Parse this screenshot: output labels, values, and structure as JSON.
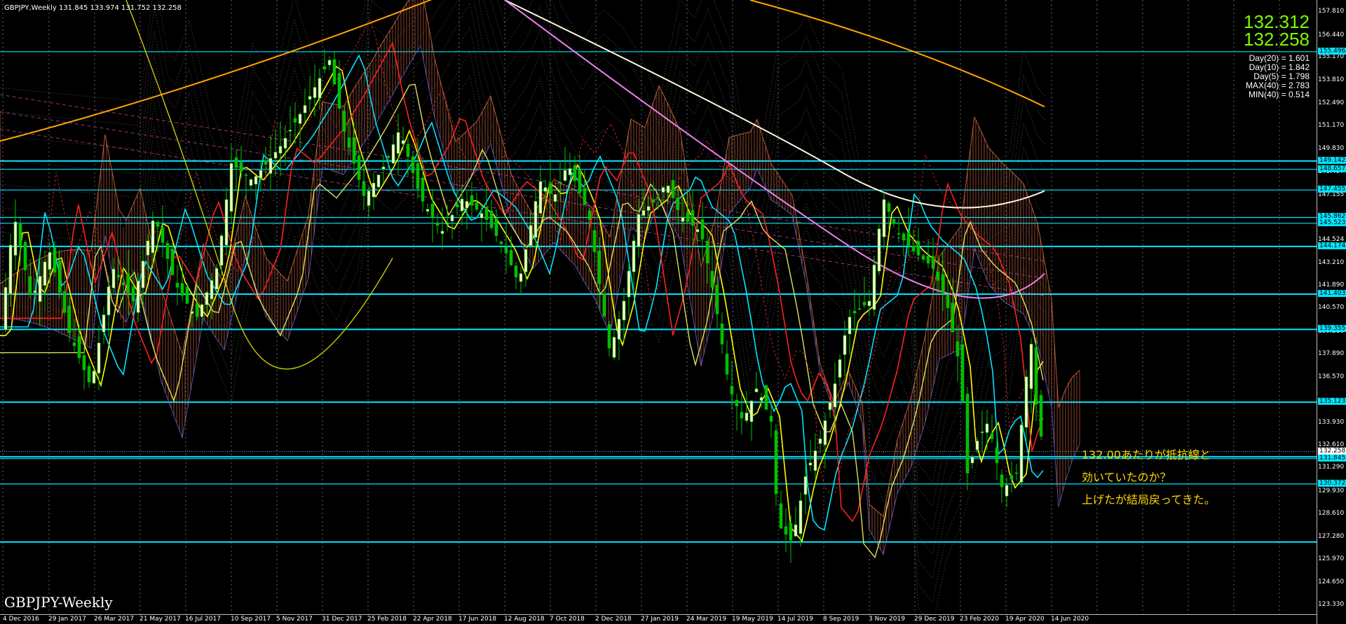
{
  "header": {
    "title": "GBPJPY,Weekly  131.845 133.974 131.752 132.258"
  },
  "symbol_label": "GBPJPY-Weekly",
  "quote": {
    "bid": "132.312",
    "ask": "132.258"
  },
  "stats": [
    "Day(20) = 1.601",
    "Day(10) = 1.842",
    "Day(5) = 1.798",
    "MAX(40) = 2.783",
    "MIN(40) = 0.514"
  ],
  "annotation": [
    "132.00あたりが抵抗線と",
    "効いていたのか？",
    "上げたが結局戻ってきた。"
  ],
  "price_ticks": [
    "157.810",
    "156.440",
    "155.170",
    "153.810",
    "152.490",
    "151.170",
    "149.830",
    "148.497",
    "147.155",
    "145.862",
    "144.524",
    "143.210",
    "141.890",
    "140.570",
    "139.210",
    "137.890",
    "136.570",
    "135.123",
    "133.930",
    "132.610",
    "131.290",
    "129.930",
    "128.610",
    "127.280",
    "125.970",
    "124.650",
    "123.330"
  ],
  "levels": [
    "155.496",
    "149.142",
    "148.657",
    "147.455",
    "145.862",
    "145.523",
    "144.174",
    "141.403",
    "139.355",
    "135.123",
    "132.258",
    "131.845",
    "130.372"
  ],
  "date_ticks": [
    "4 Dec 2016",
    "29 Jan 2017",
    "26 Mar 2017",
    "21 May 2017",
    "16 Jul 2017",
    "10 Sep 2017",
    "5 Nov 2017",
    "31 Dec 2017",
    "25 Feb 2018",
    "22 Apr 2018",
    "17 Jun 2018",
    "12 Aug 2018",
    "7 Oct 2018",
    "2 Dec 2018",
    "27 Jan 2019",
    "24 Mar 2019",
    "19 May 2019",
    "14 Jul 2019",
    "8 Sep 2019",
    "3 Nov 2019",
    "29 Dec 2019",
    "23 Feb 2020",
    "19 Apr 2020",
    "14 Jun 2020"
  ],
  "colors": {
    "background": "#000000",
    "candle_up": "#ffffcc",
    "candle_down": "#00c000",
    "level_line": "#00e5ff",
    "bid_ask": "#7cfc00",
    "annotation": "#ffd700",
    "ma_fast": "#ffff00",
    "ma_mid": "#00e5ff",
    "ma_slow": "#ff2020",
    "ma_long": "#e0e060",
    "ma_orange": "#ffa500",
    "ma_pink": "#ee82ee",
    "ma_cream": "#fff5dc",
    "cloud_bull": "#ff7f50",
    "cloud_bear": "#7070ff"
  }
}
